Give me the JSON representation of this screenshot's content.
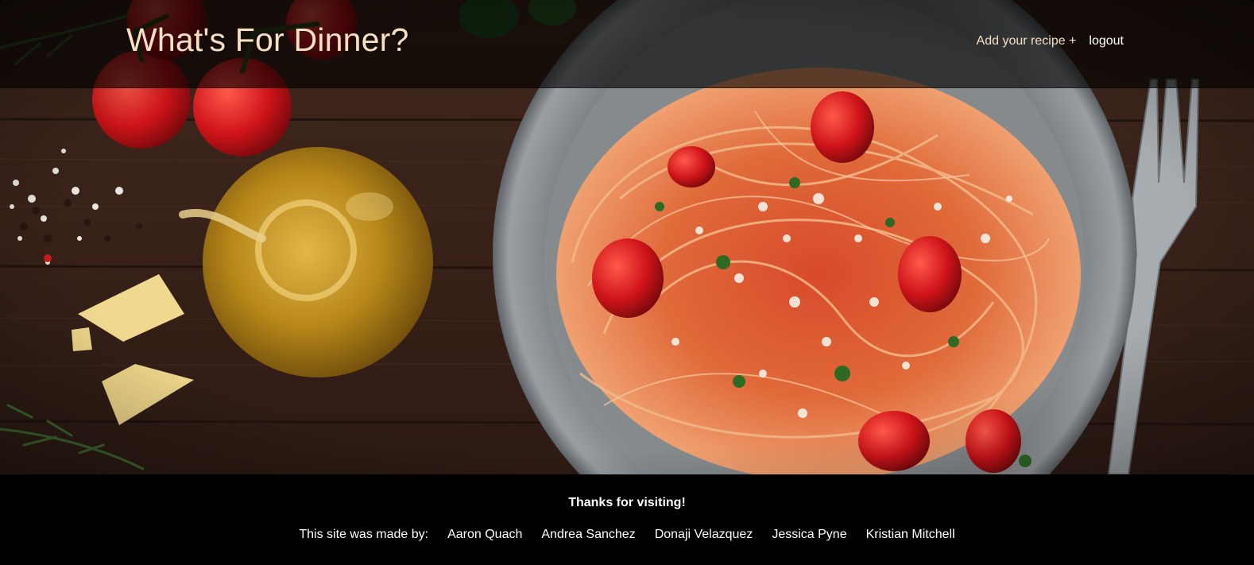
{
  "header": {
    "title": "What's For Dinner?",
    "nav": {
      "add_recipe": "Add your recipe +",
      "logout": "logout"
    }
  },
  "hero": {
    "image_subject": "spaghetti-with-tomatoes-olive-oil-parmesan-on-wooden-table"
  },
  "footer": {
    "thanks": "Thanks for visiting!",
    "made_by_label": "This site was made by:",
    "authors": [
      "Aaron Quach",
      "Andrea Sanchez",
      "Donaji Velazquez",
      "Jessica Pyne",
      "Kristian Mitchell"
    ]
  },
  "colors": {
    "title_accent": "#f7e0c4",
    "header_overlay": "rgba(0,0,0,0.62)",
    "footer_bg": "#000000",
    "table_wood": "#3a231a"
  }
}
